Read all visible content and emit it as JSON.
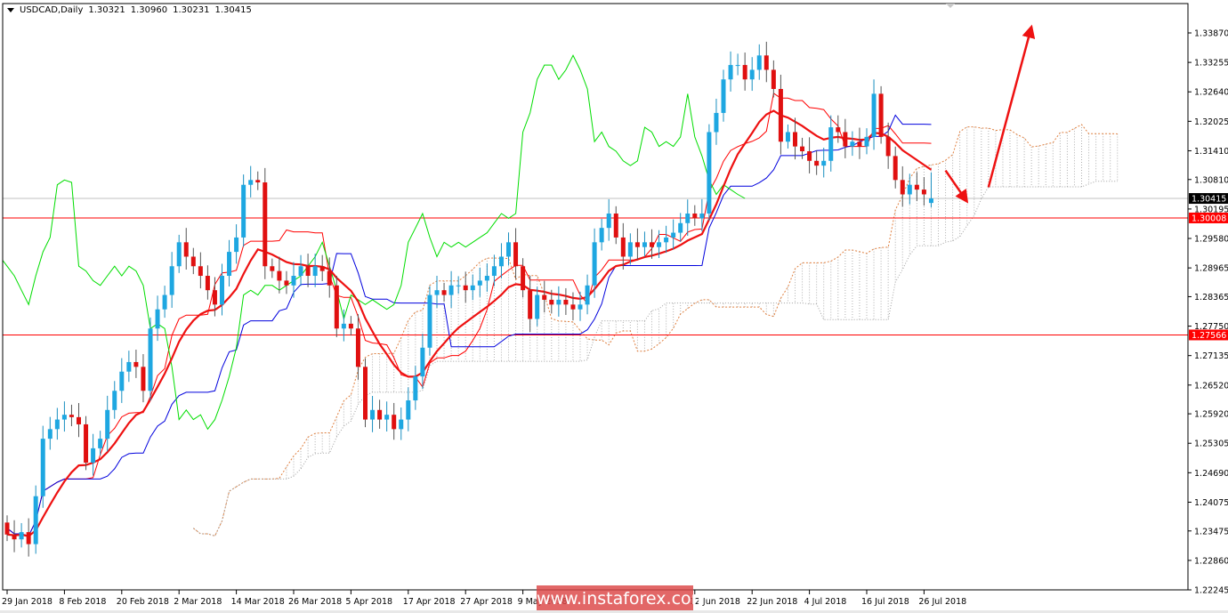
{
  "header": {
    "symbol": "USDCAD,Daily",
    "open": "1.30321",
    "high": "1.30960",
    "low": "1.30231",
    "close": "1.30415"
  },
  "watermark": "www.instaforex.com",
  "colors": {
    "bull": "#1ea7e1",
    "bear": "#e01010",
    "tenkan": "#ff0000",
    "kijun": "#0000dd",
    "chikou": "#00dd00",
    "ma": "#ee1111",
    "span_a": "#e08040",
    "span_b": "#a0a0a0",
    "level": "#ff0000",
    "arrow": "#ee1111"
  },
  "chart_data": {
    "type": "candlestick",
    "symbol": "USDCAD",
    "timeframe": "Daily",
    "ylim": [
      1.22245,
      1.3387
    ],
    "y_ticks": [
      "1.33870",
      "1.33255",
      "1.32640",
      "1.32025",
      "1.31410",
      "1.30810",
      "1.30195",
      "1.29580",
      "1.28965",
      "1.28365",
      "1.27750",
      "1.27135",
      "1.26520",
      "1.25920",
      "1.25305",
      "1.24690",
      "1.24075",
      "1.23475",
      "1.22860",
      "1.22245"
    ],
    "x_ticks": [
      {
        "bar": 0,
        "label": "29 Jan 2018"
      },
      {
        "bar": 8,
        "label": "8 Feb 2018"
      },
      {
        "bar": 16,
        "label": "20 Feb 2018"
      },
      {
        "bar": 24,
        "label": "2 Mar 2018"
      },
      {
        "bar": 32,
        "label": "14 Mar 2018"
      },
      {
        "bar": 40,
        "label": "26 Mar 2018"
      },
      {
        "bar": 48,
        "label": "5 Apr 2018"
      },
      {
        "bar": 56,
        "label": "17 Apr 2018"
      },
      {
        "bar": 64,
        "label": "27 Apr 2018"
      },
      {
        "bar": 72,
        "label": "9 May 2018"
      },
      {
        "bar": 96,
        "label": "12 Jun 2018"
      },
      {
        "bar": 104,
        "label": "22 Jun 2018"
      },
      {
        "bar": 112,
        "label": "4 Jul 2018"
      },
      {
        "bar": 120,
        "label": "16 Jul 2018"
      },
      {
        "bar": 128,
        "label": "26 Jul 2018"
      }
    ],
    "first_open": 1.2365,
    "closes": [
      1.234,
      1.233,
      1.2345,
      1.232,
      1.242,
      1.254,
      1.256,
      1.258,
      1.259,
      1.2585,
      1.257,
      1.249,
      1.252,
      1.254,
      1.26,
      1.264,
      1.268,
      1.27,
      1.269,
      1.264,
      1.277,
      1.281,
      1.284,
      1.29,
      1.295,
      1.292,
      1.29,
      1.288,
      1.285,
      1.282,
      1.288,
      1.293,
      1.296,
      1.307,
      1.308,
      1.3075,
      1.29,
      1.289,
      1.287,
      1.286,
      1.288,
      1.29,
      1.288,
      1.29,
      1.289,
      1.286,
      1.277,
      1.278,
      1.277,
      1.269,
      1.258,
      1.26,
      1.258,
      1.259,
      1.256,
      1.258,
      1.262,
      1.267,
      1.273,
      1.284,
      1.285,
      1.284,
      1.286,
      1.286,
      1.285,
      1.286,
      1.287,
      1.288,
      1.29,
      1.292,
      1.295,
      1.29,
      1.285,
      1.279,
      1.284,
      1.283,
      1.282,
      1.283,
      1.282,
      1.281,
      1.282,
      1.286,
      1.295,
      1.298,
      1.301,
      1.296,
      1.292,
      1.295,
      1.294,
      1.295,
      1.294,
      1.295,
      1.296,
      1.297,
      1.299,
      1.301,
      1.3,
      1.301,
      1.318,
      1.322,
      1.329,
      1.332,
      1.332,
      1.329,
      1.331,
      1.334,
      1.331,
      1.327,
      1.316,
      1.318,
      1.315,
      1.314,
      1.312,
      1.311,
      1.312,
      1.319,
      1.318,
      1.315,
      1.316,
      1.315,
      1.317,
      1.326,
      1.317,
      1.313,
      1.308,
      1.305,
      1.307,
      1.306,
      1.305,
      1.30415
    ],
    "last_candle": {
      "open": 1.30321,
      "high": 1.3096,
      "low": 1.30231,
      "close": 1.30415
    },
    "indicators": [
      "Ichimoku(9,26,52)",
      "Moving Average"
    ],
    "levels": [
      {
        "price": 1.30008,
        "label": "1.30008",
        "color": "#ff0000"
      },
      {
        "price": 1.27566,
        "label": "1.27566",
        "color": "#ff0000"
      }
    ],
    "current_price": {
      "price": 1.30415,
      "label": "1.30415"
    },
    "arrows": [
      {
        "from_bar": 131,
        "from_price": 1.31,
        "to_bar": 134,
        "to_price": 1.3035
      },
      {
        "from_bar": 137,
        "from_price": 1.3065,
        "to_bar": 143,
        "to_price": 1.34
      }
    ]
  }
}
